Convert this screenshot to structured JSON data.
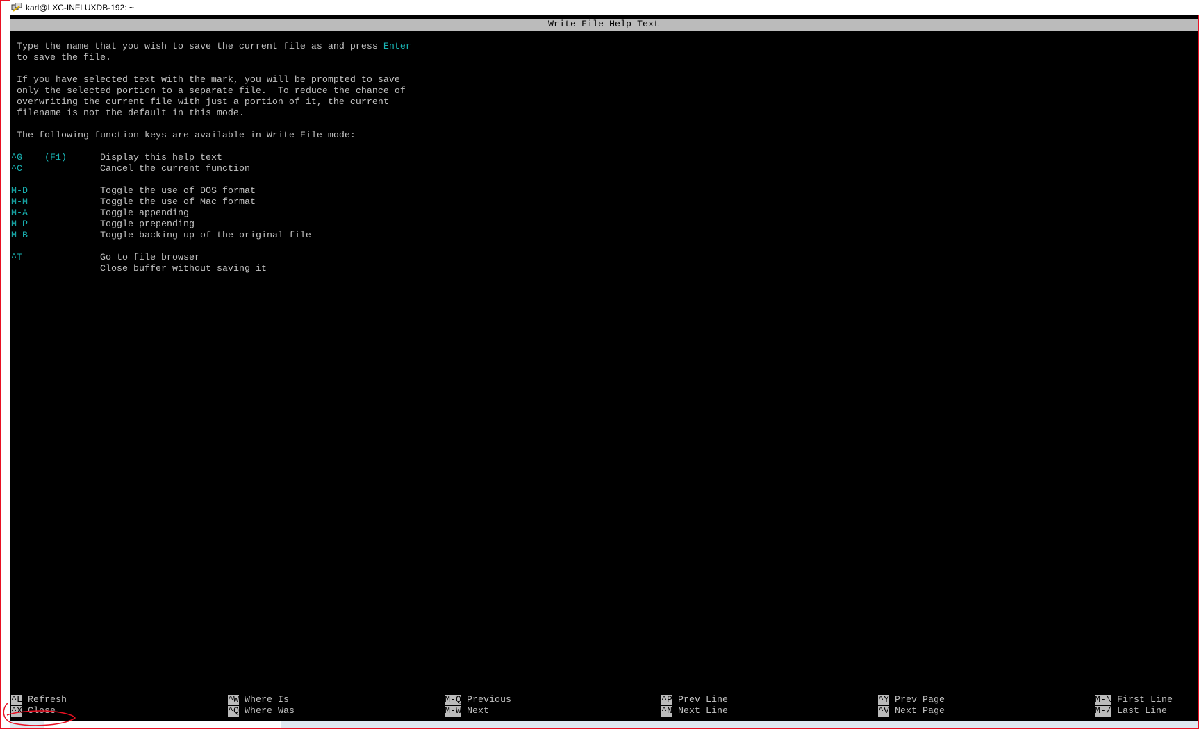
{
  "window": {
    "title": "karl@LXC-INFLUXDB-192: ~",
    "icon": "putty-icon"
  },
  "header": {
    "title": "Write File Help Text"
  },
  "help": {
    "paragraphs": [
      [
        "Type the name that you wish to save the current file as and press ",
        "to save the file."
      ],
      [
        "If you have selected text with the mark, you will be prompted to save",
        "only the selected portion to a separate file.  To reduce the chance of",
        "overwriting the current file with just a portion of it, the current",
        "filename is not the default in this mode."
      ],
      [
        "The following function keys are available in Write File mode:"
      ]
    ],
    "enter_key": "Enter",
    "keys": [
      {
        "key": "^G",
        "alt": "(F1)",
        "desc": "Display this help text"
      },
      {
        "key": "^C",
        "alt": "",
        "desc": "Cancel the current function"
      },
      {
        "key": "M-D",
        "alt": "",
        "desc": "Toggle the use of DOS format"
      },
      {
        "key": "M-M",
        "alt": "",
        "desc": "Toggle the use of Mac format"
      },
      {
        "key": "M-A",
        "alt": "",
        "desc": "Toggle appending"
      },
      {
        "key": "M-P",
        "alt": "",
        "desc": "Toggle prepending"
      },
      {
        "key": "M-B",
        "alt": "",
        "desc": "Toggle backing up of the original file"
      },
      {
        "key": "^T",
        "alt": "",
        "desc": "Go to file browser"
      },
      {
        "key": "",
        "alt": "",
        "desc": "Close buffer without saving it"
      }
    ]
  },
  "shortcuts": [
    [
      {
        "key": "^L",
        "label": "Refresh"
      },
      {
        "key": "^X",
        "label": "Close"
      }
    ],
    [
      {
        "key": "^W",
        "label": "Where Is"
      },
      {
        "key": "^Q",
        "label": "Where Was"
      }
    ],
    [
      {
        "key": "M-Q",
        "label": "Previous"
      },
      {
        "key": "M-W",
        "label": "Next"
      }
    ],
    [
      {
        "key": "^P",
        "label": "Prev Line"
      },
      {
        "key": "^N",
        "label": "Next Line"
      }
    ],
    [
      {
        "key": "^Y",
        "label": "Prev Page"
      },
      {
        "key": "^V",
        "label": "Next Page"
      }
    ],
    [
      {
        "key": "M-\\",
        "label": "First Line"
      },
      {
        "key": "M-/",
        "label": "Last Line"
      }
    ]
  ],
  "colors": {
    "key": "#19b3b3",
    "text": "#c0c0c0",
    "bar": "#bbbbbb",
    "annotation": "#e81123"
  }
}
